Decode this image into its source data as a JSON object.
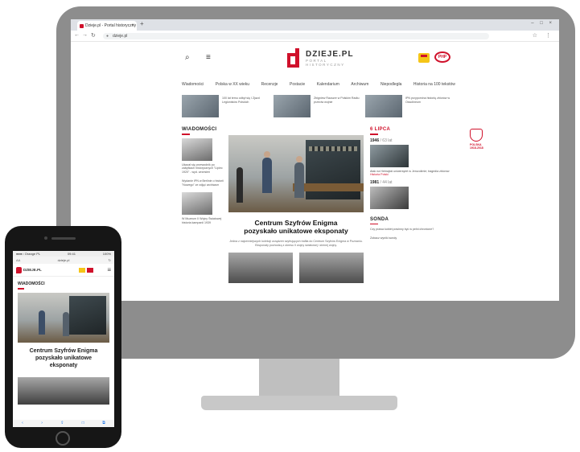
{
  "browser": {
    "tab_title": "Dzieje.pl - Portal historyczny",
    "tab_close": "×",
    "new_tab": "+",
    "window_controls": "– □ ×",
    "back": "←",
    "forward": "→",
    "reload": "↻",
    "home": "⌂",
    "url": "dzieje.pl",
    "toolbar_right": "☆ ⋮"
  },
  "site": {
    "logo_name": "DZIEJE.PL",
    "logo_sub1": "PORTAL",
    "logo_sub2": "HISTORYCZNY",
    "search_icon": "⌕",
    "menu_icon": "≡",
    "badge2": "PHP",
    "nav": [
      "Wiadomości",
      "Polska w XX wieku",
      "Recenzje",
      "Postacie",
      "Kalendarium",
      "Archiwum",
      "Niepodległa",
      "Historia na 100 tekstów"
    ],
    "teasers": [
      "100 lat temu odbył się I Zjazd Legionistów Polskich",
      "Zbigniew Rauszer w Polskim Radiu: przeciw wojnie",
      "IPN przypomina historię zbiorów w Ossolineum"
    ],
    "left": {
      "title": "WIADOMOŚCI",
      "items": [
        "Ukazał się przewodnik po zabytkach historycznych \"Lipiec 1920\" - wyd. wrzesień",
        "Wydanie IPN w Berlinie o historii \"Nowego\" ze zdjęć archiwum",
        "W Muzeum II Wojny Światowej historia kampanii 1939"
      ]
    },
    "hero": {
      "title_line1": "Centrum Szyfrów Enigma",
      "title_line2": "pozyskało unikatowe eksponaty",
      "lead": "Jedna z najcenniejszych kolekcji urządzeń szyfrujących trafiła do Centrum Szyfrów Enigma w Poznaniu. Eksponaty pochodzą z okresu II wojny światowej i zimnej wojny."
    },
    "right": {
      "title": "6 LIPCA",
      "years": [
        {
          "year": "1946",
          "label": "/ 63 lat",
          "text": "Atak na Hebrajski uniwersytet w Jerozolimie; tragedia zbiorów",
          "link": "Historia Polski"
        },
        {
          "year": "1981",
          "label": "/ 44 lat",
          "text": ""
        }
      ],
      "section2": "SONDA",
      "sonda_text": "Czy prawa kobiet powinny być w pełni chronione?",
      "sonda_option": "Zobacz wyniki sondy"
    },
    "side_badge": "POLSKA 1918-2018"
  },
  "phone": {
    "status_left": "●●●○ Orange PL",
    "status_time": "09:41",
    "status_right": "100%",
    "url": "dzieje.pl",
    "aa": "AA",
    "reload": "↻",
    "logo_text": "DZIEJE.PL",
    "menu": "≡",
    "section": "WIADOMOŚCI",
    "title_line1": "Centrum Szyfrów Enigma",
    "title_line2": "pozyskało unikatowe",
    "title_line3": "eksponaty",
    "tabbar": [
      "‹",
      "›",
      "⇪",
      "□",
      "⧉"
    ]
  }
}
